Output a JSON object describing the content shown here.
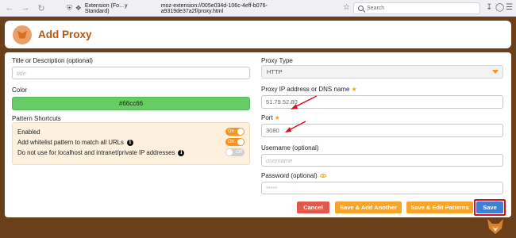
{
  "browser": {
    "back": "←",
    "forward": "→",
    "refresh": "↻",
    "url_ext": "Extension (Fo…y Standard)",
    "url_path": "moz-extension://005e034d-106c-4eff-b076-a9319de37a2f/proxy.html",
    "search_placeholder": "Search"
  },
  "header": {
    "title": "Add Proxy"
  },
  "form": {
    "title_label": "Title or Description (optional)",
    "title_placeholder": "title",
    "color_label": "Color",
    "color_value": "#66cc66",
    "shortcuts_label": "Pattern Shortcuts",
    "shortcuts": [
      {
        "label": "Enabled",
        "state": "On",
        "info": false
      },
      {
        "label": "Add whitelist pattern to match all URLs",
        "state": "On",
        "info": true
      },
      {
        "label": "Do not use for localhost and intranet/private IP addresses",
        "state": "Off",
        "info": true
      }
    ],
    "proxy_type_label": "Proxy Type",
    "proxy_type_value": "HTTP",
    "ip_label": "Proxy IP address or DNS name",
    "ip_value": "51.79.52.80",
    "port_label": "Port",
    "port_value": "3080",
    "username_label": "Username (optional)",
    "username_placeholder": "username",
    "password_label": "Password (optional)",
    "password_placeholder": "*****"
  },
  "buttons": {
    "cancel": "Cancel",
    "save_add": "Save & Add Another",
    "save_edit": "Save & Edit Patterns",
    "save": "Save"
  },
  "colors": {
    "brand": "#b8580f",
    "accent": "#f7941d",
    "background": "#6b3f1a",
    "cancel": "#e05a4b",
    "save": "#3f7fd4",
    "highlight": "#d6121e"
  },
  "icons": {
    "back": "arrow-left-icon",
    "forward": "arrow-right-icon",
    "refresh": "reload-icon",
    "shield": "shield-icon",
    "extension": "puzzle-icon",
    "bookmark": "star-icon",
    "search": "search-icon",
    "downloads": "download-icon",
    "account": "account-icon",
    "menu": "hamburger-menu-icon",
    "logo": "foxyproxy-logo-icon",
    "info": "info-icon",
    "required": "required-star-icon",
    "password_eye": "eye-icon"
  }
}
